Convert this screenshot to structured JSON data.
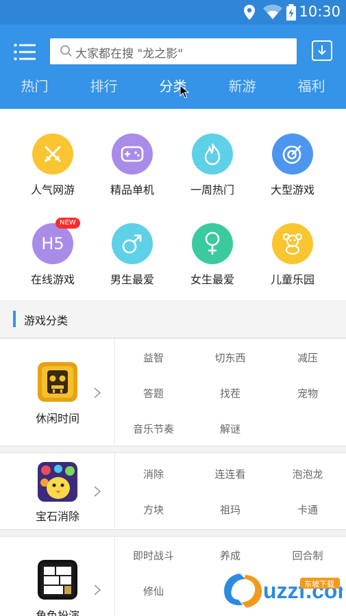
{
  "status": {
    "time": "10:30"
  },
  "header": {
    "search_placeholder": "大家都在搜 \"龙之影\"",
    "tabs": [
      {
        "label": "热门"
      },
      {
        "label": "排行"
      },
      {
        "label": "分类"
      },
      {
        "label": "新游"
      },
      {
        "label": "福利"
      }
    ],
    "active_tab": "分类"
  },
  "categories": [
    {
      "label": "人气网游",
      "color": "#f9c531",
      "icon": "crossed-swords-icon"
    },
    {
      "label": "精品单机",
      "color": "#a98ce8",
      "icon": "gamepad-icon"
    },
    {
      "label": "一周热门",
      "color": "#5ed0e8",
      "icon": "flame-icon"
    },
    {
      "label": "大型游戏",
      "color": "#4d96f0",
      "icon": "target-icon"
    },
    {
      "label": "在线游戏",
      "color": "#a98ce8",
      "icon": "h5-icon",
      "badge": "NEW",
      "glyph": "H5"
    },
    {
      "label": "男生最爱",
      "color": "#5ed0e8",
      "icon": "male-icon"
    },
    {
      "label": "女生最爱",
      "color": "#3bc9a0",
      "icon": "female-icon"
    },
    {
      "label": "儿童乐园",
      "color": "#f9c531",
      "icon": "teddy-bear-icon"
    }
  ],
  "section": {
    "title": "游戏分类"
  },
  "groups": [
    {
      "name": "休闲时间",
      "tags": [
        "益智",
        "切东西",
        "减压",
        "答题",
        "找茬",
        "宠物",
        "音乐节奏",
        "解谜"
      ]
    },
    {
      "name": "宝石消除",
      "tags": [
        "消除",
        "连连看",
        "泡泡龙",
        "方块",
        "祖玛",
        "卡通"
      ]
    },
    {
      "name": "角色扮演",
      "tags": [
        "即时战斗",
        "养成",
        "回合制",
        "修仙"
      ]
    }
  ],
  "watermark": {
    "text": "uzzf.com",
    "subtext": "东坡下载"
  }
}
